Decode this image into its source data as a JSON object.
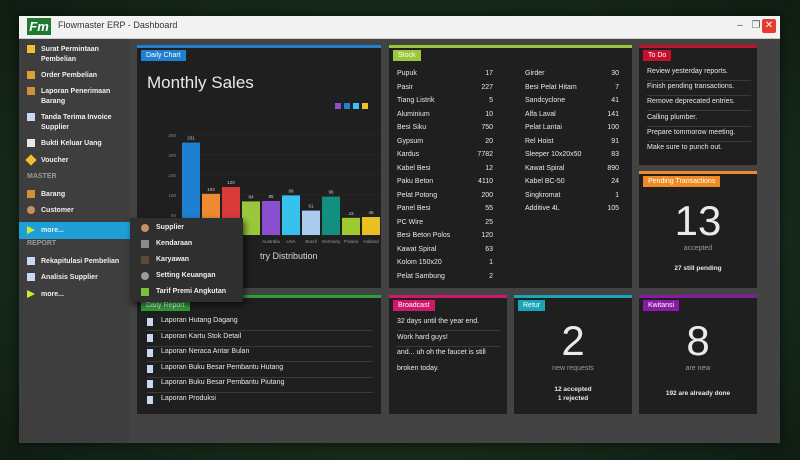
{
  "window": {
    "title": "Flowmaster ERP - Dashboard",
    "logo": "Fm"
  },
  "window_controls": {
    "minimize": "–",
    "maximize": "❐",
    "close": "✕"
  },
  "sidebar": {
    "top_items": [
      {
        "label": "Surat Permintaan Pembelian",
        "icon": "pencil-icon"
      },
      {
        "label": "Order Pembelian",
        "icon": "cart-icon"
      },
      {
        "label": "Laporan Penerimaan Barang",
        "icon": "box-icon"
      },
      {
        "label": "Tanda Terima Invoice Supplier",
        "icon": "document-icon"
      },
      {
        "label": "Bukti Keluar Uang",
        "icon": "receipt-icon"
      },
      {
        "label": "Voucher",
        "icon": "tag-icon"
      }
    ],
    "master_label": "MASTER",
    "master_items": [
      {
        "label": "Barang",
        "icon": "box-icon"
      },
      {
        "label": "Customer",
        "icon": "user-icon"
      },
      {
        "label": "more...",
        "icon": "arrow-right-icon"
      }
    ],
    "report_label": "REPORT",
    "report_items": [
      {
        "label": "Rekapitulasi Pembelian",
        "icon": "report-icon"
      },
      {
        "label": "Analisis Supplier",
        "icon": "report-icon"
      },
      {
        "label": "more...",
        "icon": "arrow-right-icon"
      }
    ],
    "active_color": "#1f9fd8"
  },
  "popup": {
    "items": [
      {
        "label": "Supplier",
        "icon": "person-icon"
      },
      {
        "label": "Kendaraan",
        "icon": "truck-icon"
      },
      {
        "label": "Karyawan",
        "icon": "employee-icon"
      },
      {
        "label": "Setting Keuangan",
        "icon": "gear-icon"
      },
      {
        "label": "Tarif Premi Angkutan",
        "icon": "bottle-icon"
      }
    ]
  },
  "daily_chart": {
    "tag": "Daily Chart",
    "title": "Monthly Sales",
    "subtitle": "try Distribution",
    "accent": "#1f7fd0",
    "legend_colors": [
      "#8a4fd0",
      "#1f7fd0",
      "#36c1ee",
      "#f0c030"
    ]
  },
  "chart_data": {
    "type": "bar",
    "title": "Monthly Sales",
    "categories": [
      "",
      "",
      "",
      "",
      "Australia",
      "USA",
      "Brazil",
      "Germany",
      "Poland",
      "Holland"
    ],
    "values": [
      231,
      103,
      120,
      84,
      85,
      99,
      61,
      96,
      43,
      45
    ],
    "colors": [
      "#1f7fd0",
      "#f08a30",
      "#d93a3a",
      "#9ac83a",
      "#8a4fd0",
      "#36c1ee",
      "#aaccee",
      "#138f7f",
      "#a0c830",
      "#e8c020"
    ],
    "y_ticks": [
      "0",
      "50",
      "100",
      "150",
      "200",
      "250"
    ],
    "ylim": [
      0,
      250
    ]
  },
  "stock": {
    "tag": "Stock",
    "accent": "#9ac83a",
    "left": [
      {
        "name": "Pupuk",
        "qty": "17"
      },
      {
        "name": "Pasir",
        "qty": "227"
      },
      {
        "name": "Tiang Listrik",
        "qty": "5"
      },
      {
        "name": "Aluminium",
        "qty": "10"
      },
      {
        "name": "Besi Siku",
        "qty": "750"
      },
      {
        "name": "Gypsum",
        "qty": "20"
      },
      {
        "name": "Kardus",
        "qty": "7782"
      },
      {
        "name": "Kabel Besi",
        "qty": "12"
      },
      {
        "name": "Paku Beton",
        "qty": "4110"
      },
      {
        "name": "Pelat Potong",
        "qty": "200"
      },
      {
        "name": "Panel Besi",
        "qty": "55"
      },
      {
        "name": "PC Wire",
        "qty": "25"
      },
      {
        "name": "Besi Beton Polos",
        "qty": "120"
      },
      {
        "name": "Kawat Spiral",
        "qty": "63"
      },
      {
        "name": "Kolom 150x20",
        "qty": "1"
      },
      {
        "name": "Pelat Sambung",
        "qty": "2"
      }
    ],
    "right": [
      {
        "name": "Girder",
        "qty": "30"
      },
      {
        "name": "Besi Pelat Hitam",
        "qty": "7"
      },
      {
        "name": "Sandcyclone",
        "qty": "41"
      },
      {
        "name": "Alfa Laval",
        "qty": "141"
      },
      {
        "name": "Pelat Lantai",
        "qty": "100"
      },
      {
        "name": "Rel Hoist",
        "qty": "91"
      },
      {
        "name": "Sleeper 10x20x50",
        "qty": "83"
      },
      {
        "name": "Kawat Spiral",
        "qty": "890"
      },
      {
        "name": "Kabel BC-50",
        "qty": "24"
      },
      {
        "name": "Singkromat",
        "qty": "1"
      },
      {
        "name": "Additive 4L",
        "qty": "105"
      }
    ]
  },
  "todo": {
    "tag": "To Do",
    "accent": "#c8102e",
    "items": [
      "Review yesterday reports.",
      "Finish pending transactions.",
      "Remove deprecated entries.",
      "Calling plumber.",
      "Prepare tommorow meeting.",
      "Make sure to punch out."
    ]
  },
  "pending": {
    "tag": "Pending Transactions",
    "accent": "#f08a24",
    "count": "13",
    "label": "accepted",
    "footer": "27 still pending"
  },
  "daily_report": {
    "tag": "Daily Report",
    "accent": "#2e9e3a",
    "items": [
      "Laporan Hutang Dagang",
      "Laporan Kartu Stok Detail",
      "Laporan Neraca Antar Bulan",
      "Laporan Buku Besar Pembantu Hutang",
      "Laporan Buku Besar Pembantu Piutang",
      "Laporan Produksi"
    ]
  },
  "broadcast": {
    "tag": "Broadcast",
    "accent": "#d0186a",
    "lines": [
      "32 days until the year end.",
      "Work hard guys!",
      "and... uh oh the faucet is still",
      "broken today."
    ]
  },
  "retur": {
    "tag": "Retur",
    "accent": "#1aa6b7",
    "count": "2",
    "label": "new requests",
    "footer1": "12 accepted",
    "footer2": "1 rejected"
  },
  "kwitansi": {
    "tag": "Kwitansi",
    "accent": "#8a1aa6",
    "count": "8",
    "label": "are new",
    "footer": "192 are already done"
  }
}
